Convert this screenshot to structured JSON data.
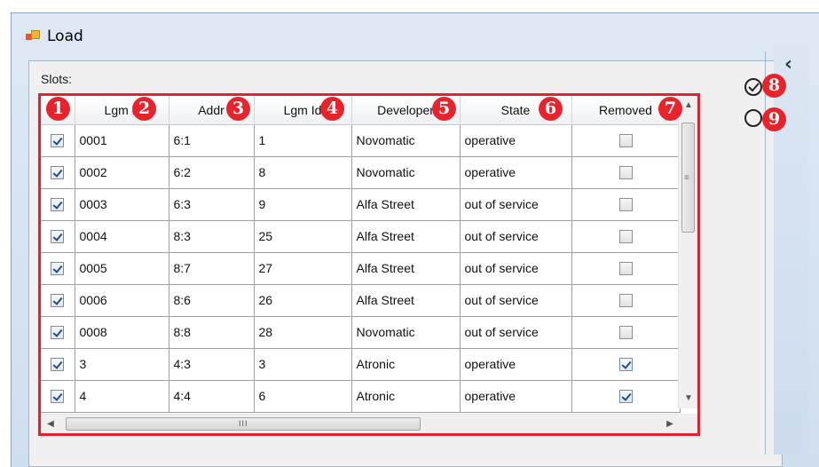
{
  "window": {
    "title": "Load"
  },
  "slots_group": {
    "label": "Slots:"
  },
  "grid": {
    "columns": [
      "",
      "Lgm #",
      "Addr",
      "Lgm Id",
      "Developer",
      "State",
      "Removed"
    ],
    "rows": [
      {
        "selected": true,
        "lgm_no": "0001",
        "addr": "6:1",
        "lgm_id": "1",
        "developer": "Novomatic",
        "state": "operative",
        "removed": false
      },
      {
        "selected": true,
        "lgm_no": "0002",
        "addr": "6:2",
        "lgm_id": "8",
        "developer": "Novomatic",
        "state": "operative",
        "removed": false
      },
      {
        "selected": true,
        "lgm_no": "0003",
        "addr": "6:3",
        "lgm_id": "9",
        "developer": "Alfa Street",
        "state": "out of service",
        "removed": false
      },
      {
        "selected": true,
        "lgm_no": "0004",
        "addr": "8:3",
        "lgm_id": "25",
        "developer": "Alfa Street",
        "state": "out of service",
        "removed": false
      },
      {
        "selected": true,
        "lgm_no": "0005",
        "addr": "8:7",
        "lgm_id": "27",
        "developer": "Alfa Street",
        "state": "out of service",
        "removed": false
      },
      {
        "selected": true,
        "lgm_no": "0006",
        "addr": "8:6",
        "lgm_id": "26",
        "developer": "Alfa Street",
        "state": "out of service",
        "removed": false
      },
      {
        "selected": true,
        "lgm_no": "0008",
        "addr": "8:8",
        "lgm_id": "28",
        "developer": "Novomatic",
        "state": "out of service",
        "removed": false
      },
      {
        "selected": true,
        "lgm_no": "3",
        "addr": "4:3",
        "lgm_id": "3",
        "developer": "Atronic",
        "state": "operative",
        "removed": true
      },
      {
        "selected": true,
        "lgm_no": "4",
        "addr": "4:4",
        "lgm_id": "6",
        "developer": "Atronic",
        "state": "operative",
        "removed": true
      }
    ]
  },
  "scrollbar": {
    "h_grip": "III",
    "v_grip": "≡"
  },
  "badges": [
    "1",
    "2",
    "3",
    "4",
    "5",
    "6",
    "7",
    "8",
    "9"
  ],
  "icons": {
    "check_all": "check-all-icon",
    "uncheck_all": "uncheck-all-icon",
    "collapse": "chevron-left-icon"
  },
  "colors": {
    "annotation_red": "#e8232c",
    "title_bar": "#dfe9f5"
  }
}
